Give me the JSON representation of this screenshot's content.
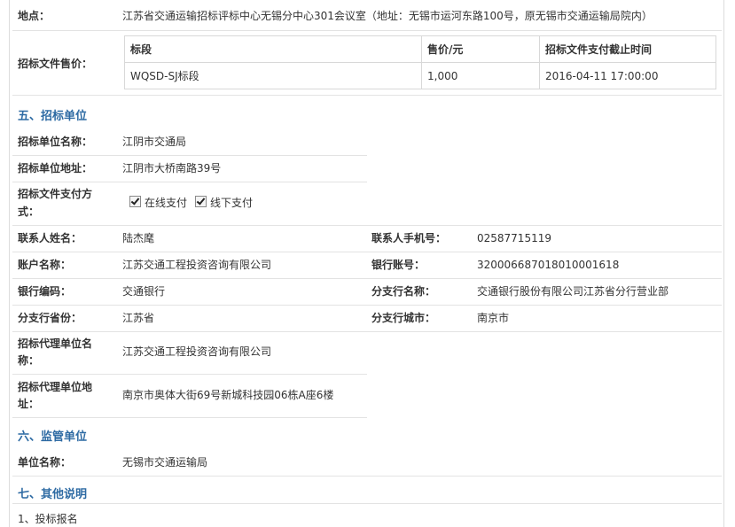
{
  "location": {
    "label": "地点：",
    "value": "江苏省交通运输招标评标中心无锡分中心301会议室（地址：无锡市运河东路100号，原无锡市交通运输局院内）"
  },
  "fee": {
    "label": "招标文件售价：",
    "headers": [
      "标段",
      "售价/元",
      "招标文件支付截止时间"
    ],
    "row": [
      "WQSD-SJ标段",
      "1,000",
      "2016-04-11 17:00:00"
    ]
  },
  "section5": {
    "title": "五、招标单位"
  },
  "unit": {
    "name_label": "招标单位名称：",
    "name": "江阴市交通局",
    "addr_label": "招标单位地址：",
    "addr": "江阴市大桥南路39号",
    "pay_label_1": "招标文件支付方",
    "pay_label_2": "式：",
    "pay_online": "在线支付",
    "pay_offline": "线下支付",
    "contact_label": "联系人姓名：",
    "contact": "陆杰麾",
    "mobile_label": "联系人手机号：",
    "mobile": "02587715119",
    "account_label": "账户名称：",
    "account": "江苏交通工程投资咨询有限公司",
    "bankno_label": "银行账号：",
    "bankno": "32000668701801000161​8",
    "bankcode_label": "银行编码：",
    "bankcode": "交通银行",
    "branch_label": "分支行名称：",
    "branch": "交通银行股份有限公司江苏省分行营业部",
    "prov_label": "分支行省份：",
    "prov": "江苏省",
    "city_label": "分支行城市：",
    "city": "南京市",
    "agent_label_1": "招标代理单位名",
    "agent_label_2": "称：",
    "agent": "江苏交通工程投资咨询有限公司",
    "agentaddr_label_1": "招标代理单位地",
    "agentaddr_label_2": "址：",
    "agentaddr": "南京市奥体大街69号新城科技园06栋A座6楼"
  },
  "section6": {
    "title": "六、监管单位"
  },
  "supervisor": {
    "label": "单位名称：",
    "value": "无锡市交通运输局"
  },
  "section7": {
    "title": "七、其他说明"
  },
  "note": {
    "line1": "1、投标报名"
  }
}
